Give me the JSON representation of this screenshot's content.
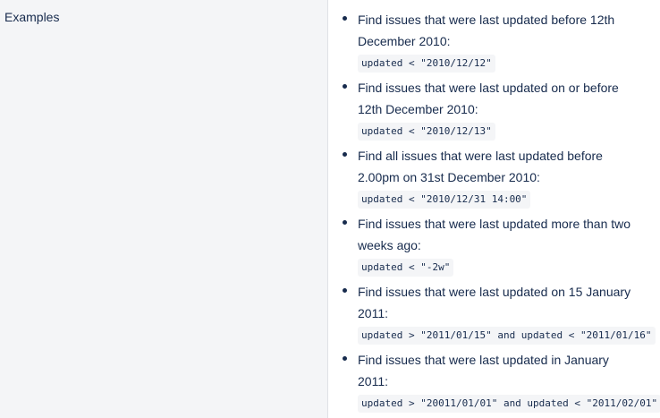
{
  "section": {
    "heading": "Examples"
  },
  "examples": [
    {
      "description": "Find issues that were last updated before 12th December 2010:",
      "code": "updated < \"2010/12/12\""
    },
    {
      "description": "Find issues that were last updated on or before 12th December 2010:",
      "code": "updated < \"2010/12/13\""
    },
    {
      "description": "Find all issues that were last updated before 2.00pm on 31st December 2010:",
      "code": "updated < \"2010/12/31 14:00\""
    },
    {
      "description": "Find issues that were last updated more than two weeks ago:",
      "code": "updated < \"-2w\""
    },
    {
      "description": "Find issues that were last updated on 15 January 2011:",
      "code": "updated > \"2011/01/15\" and updated < \"2011/01/16\""
    },
    {
      "description": "Find issues that were last updated in January 2011:",
      "code": "updated > \"20011/01/01\" and updated < \"2011/02/01\""
    }
  ],
  "colors": {
    "text": "#172b4d",
    "heading_background": "#f4f5f7",
    "code_background": "#f4f5f7",
    "divider": "#dfe1e6"
  }
}
